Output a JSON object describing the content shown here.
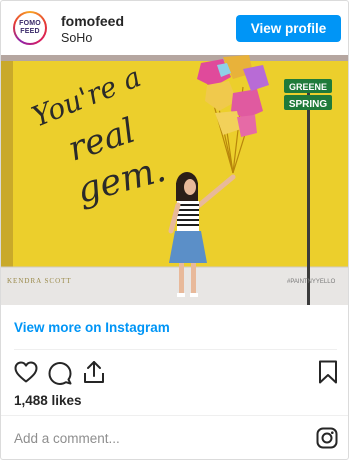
{
  "post": {
    "username": "fomofeed",
    "location": "SoHo",
    "avatar_text_line1": "FOMO",
    "avatar_text_line2": "FEED",
    "view_profile_label": "View profile",
    "view_more_label": "View more on Instagram",
    "likes_text": "1,488 likes",
    "add_comment_placeholder": "Add a comment..."
  },
  "photo": {
    "mural_text_line1": "You're a",
    "mural_text_line2": "real",
    "mural_text_line3": "gem.",
    "street_sign_top": "GREENE",
    "street_sign_bottom": "SPRING",
    "artist_credit": "KENDRA SCOTT",
    "hashtag": "#PAINTNYYELLO"
  },
  "icons": {
    "heart": "heart-icon",
    "comment": "comment-icon",
    "share": "share-icon",
    "bookmark": "bookmark-icon",
    "instagram": "instagram-icon"
  },
  "colors": {
    "accent": "#0095f6",
    "wall": "#eccf2c",
    "sign_green": "#1f7a3a"
  }
}
